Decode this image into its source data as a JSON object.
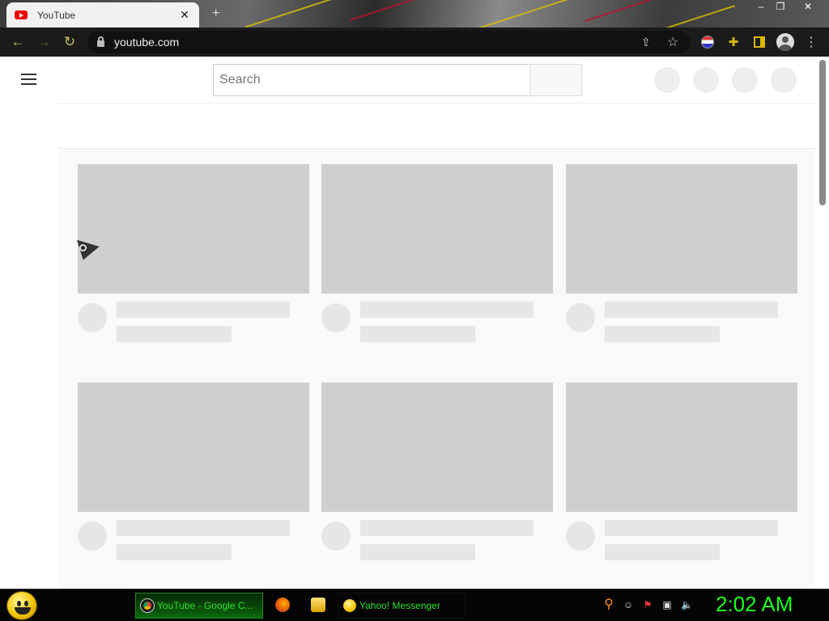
{
  "browser": {
    "tab": {
      "title": "YouTube",
      "close_glyph": "✕"
    },
    "new_tab_glyph": "+",
    "window_controls": [
      "–",
      "❐",
      "✕"
    ],
    "toolbar": {
      "back_glyph": "←",
      "forward_glyph": "→",
      "reload_glyph": "↻",
      "url": "youtube.com",
      "share_glyph": "⇪",
      "bookmark_glyph": "☆",
      "extensions_glyph": "✚",
      "menu_glyph": "⋮"
    }
  },
  "youtube": {
    "search_placeholder": "Search",
    "masthead_icons": [
      "create-icon",
      "apps-icon",
      "notifications-icon",
      "account-icon"
    ],
    "placeholder_cards": 6
  },
  "taskbar": {
    "items": [
      {
        "label": "YouTube - Google C...",
        "icon": "chrome-icon",
        "active": true
      },
      {
        "label": "Yahoo! Messenger",
        "icon": "yahoo-messenger-icon",
        "active": false
      }
    ],
    "quicklaunch": [
      "firefox-icon",
      "explorer-folder-icon"
    ],
    "tray": [
      "search-icon",
      "messenger-tray-icon",
      "flag-icon",
      "network-icon",
      "volume-icon"
    ],
    "tray_glyphs": {
      "search": "⚲",
      "messenger": "☺",
      "flag": "⚑",
      "network": "▣",
      "volume": "🔈"
    },
    "clock": "2:02 AM"
  },
  "colors": {
    "accent_toolbar": "#d6b800",
    "taskbar_text": "#2fe02f",
    "clock": "#19ff19",
    "youtube_red": "#ee0000"
  }
}
